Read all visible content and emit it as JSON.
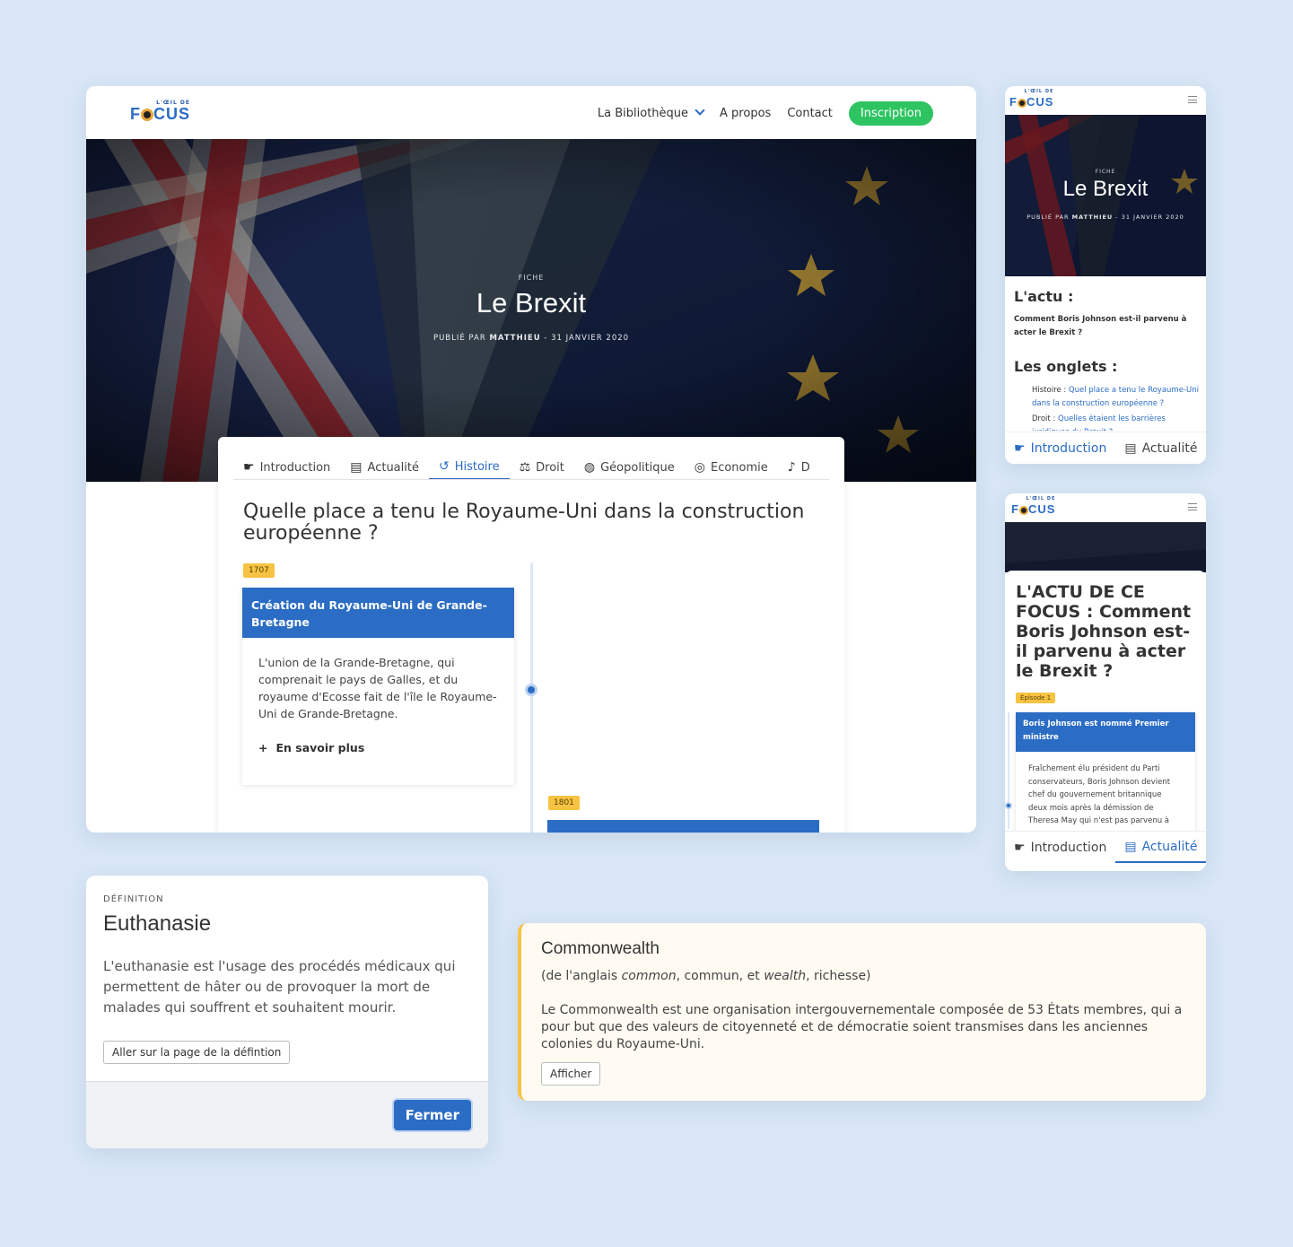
{
  "site": {
    "logo_top": "L'ŒIL DE",
    "logo_f": "F",
    "logo_cus": "CUS"
  },
  "nav": {
    "library": "La Bibliothèque",
    "about": "A propos",
    "contact": "Contact",
    "signup": "Inscription"
  },
  "hero": {
    "kicker": "FICHE",
    "title": "Le Brexit",
    "meta_prefix": "PUBLIÉ PAR ",
    "meta_author": "MATTHIEU",
    "meta_date": " - 31 JANVIER 2020"
  },
  "tabs": [
    {
      "label": "Introduction",
      "icon": "hand-point-icon"
    },
    {
      "label": "Actualité",
      "icon": "newspaper-icon"
    },
    {
      "label": "Histoire",
      "icon": "history-icon"
    },
    {
      "label": "Droit",
      "icon": "scale-icon"
    },
    {
      "label": "Géopolitique",
      "icon": "globe-icon"
    },
    {
      "label": "Economie",
      "icon": "coins-icon"
    },
    {
      "label": "D",
      "icon": "microphone-icon"
    }
  ],
  "histoire": {
    "question": "Quelle place a tenu le Royaume-Uni dans la construction européenne ?",
    "events": [
      {
        "year": "1707",
        "title": "Création du Royaume-Uni de Grande-Bretagne",
        "body": "L'union de la Grande-Bretagne, qui comprenait le pays de Galles, et du royaume d'Ecosse fait de l'île le Royaume-Uni de Grande-Bretagne.",
        "more": "En savoir plus"
      },
      {
        "year": "1801"
      }
    ]
  },
  "mobile1": {
    "kicker": "FICHE",
    "title": "Le Brexit",
    "meta_prefix": "PUBLIÉ PAR ",
    "meta_author": "MATTHIEU",
    "meta_date": " - 31 JANVIER 2020",
    "actu_heading": "L'actu :",
    "actu_text": "Comment Boris Johnson est-il parvenu à acter le Brexit ?",
    "onglets_heading": "Les onglets :",
    "onglets": [
      {
        "prefix": "Histoire : ",
        "link": "Quel place a tenu le Royaume-Uni dans la construction européenne ?"
      },
      {
        "prefix": "Droit : ",
        "link": "Quelles étaient les barrières juridiques du Brexit ?"
      }
    ],
    "tab1": "Introduction",
    "tab2": "Actualité"
  },
  "mobile2": {
    "title": "L'ACTU DE CE FOCUS : Comment Boris Johnson est-il parvenu à acter le Brexit ?",
    "episode": "Épisode 1",
    "card_title": "Boris Johnson est nommé Premier ministre",
    "card_body": "Fraîchement élu président du Parti conservateurs, Boris Johnson devient chef du gouvernement britannique deux mois après la démission de Theresa May qui n'est pas parvenu à",
    "tab1": "Introduction",
    "tab2": "Actualité"
  },
  "definition": {
    "kicker": "DÉFINITION",
    "title": "Euthanasie",
    "body": "L'euthanasie est l'usage des procédés médicaux qui permettent de hâter ou de provoquer la mort de malades qui souffrent et souhaitent mourir.",
    "link_button": "Aller sur la page de la défintion",
    "close_button": "Fermer"
  },
  "commonwealth": {
    "title": "Commonwealth",
    "sub_a": "(de l'anglais ",
    "sub_b": "common",
    "sub_c": ", commun, et ",
    "sub_d": "wealth",
    "sub_e": ", richesse)",
    "body": "Le Commonwealth est une organisation intergouvernementale composée de 53 États membres, qui a pour but que des valeurs de citoyenneté et de démocratie soient transmises dans les anciennes colonies du Royaume-Uni.",
    "button": "Afficher"
  },
  "colors": {
    "accent": "#2b6cc4",
    "green": "#2ec462",
    "year_badge": "#f6c342",
    "background": "#d8e6f5"
  }
}
